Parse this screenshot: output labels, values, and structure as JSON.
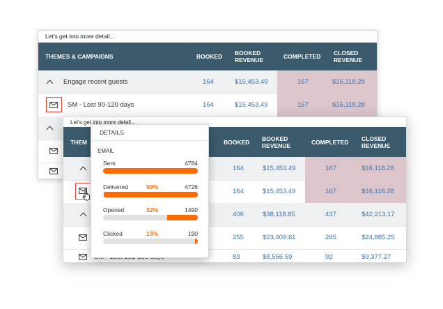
{
  "panel_back": {
    "title": "Let's get into more detail...",
    "headers": {
      "theme": "THEMES & CAMPAIGNS",
      "booked": "BOOKED",
      "booked_revenue": "BOOKED REVENUE",
      "completed": "COMPLETED",
      "closed_revenue": "CLOSED REVENUE"
    },
    "group": {
      "label": "Engage recent guests",
      "booked": "164",
      "booked_revenue": "$15,453.49",
      "completed": "167",
      "closed_revenue": "$16,118.28"
    },
    "row": {
      "label": "SM - Lost 90-120 days",
      "booked": "164",
      "booked_revenue": "$15,453.49",
      "completed": "167",
      "closed_revenue": "$16,118.28"
    }
  },
  "panel_front": {
    "title": "Let's get into more detail...",
    "headers": {
      "theme": "THEM",
      "booked": "BOOKED",
      "booked_revenue": "BOOKED REVENUE",
      "completed": "COMPLETED",
      "closed_revenue": "CLOSED REVENUE"
    },
    "rows": [
      {
        "booked": "164",
        "booked_revenue": "$15,453.49",
        "completed": "167",
        "closed_revenue": "$16,118.28"
      },
      {
        "booked": "164",
        "booked_revenue": "$15,453.49",
        "completed": "167",
        "closed_revenue": "$16,118.28"
      },
      {
        "booked": "406",
        "booked_revenue": "$38,118.85",
        "completed": "437",
        "closed_revenue": "$42,213.17"
      },
      {
        "booked": "255",
        "booked_revenue": "$23,409.61",
        "completed": "265",
        "closed_revenue": "$24,885.25"
      },
      {
        "label": "SM - Lost 151-180 days",
        "booked": "83",
        "booked_revenue": "$8,556.59",
        "completed": "92",
        "closed_revenue": "$9,377.27"
      }
    ]
  },
  "popover": {
    "title": "DETAILS",
    "section": "EMAIL",
    "metrics": [
      {
        "label": "Sent",
        "percent": "",
        "value": "4784",
        "fill_fraction": 1.0
      },
      {
        "label": "Delivered",
        "percent": "99%",
        "value": "4726",
        "fill_fraction": 0.99
      },
      {
        "label": "Opened",
        "percent": "32%",
        "value": "1490",
        "fill_fraction": 0.32
      },
      {
        "label": "Clicked",
        "percent": "13%",
        "value": "190",
        "fill_fraction": 0.03
      }
    ]
  },
  "colors": {
    "header_bg": "#3b5a6b",
    "link": "#3a73b5",
    "closed_bg": "#dcc6cc",
    "accent": "#ff6a00",
    "highlight": "#e0443b"
  },
  "icons": {
    "envelope": "envelope-icon",
    "chevron_up": "chevron-up-icon",
    "cursor": "pointer-cursor-icon"
  }
}
